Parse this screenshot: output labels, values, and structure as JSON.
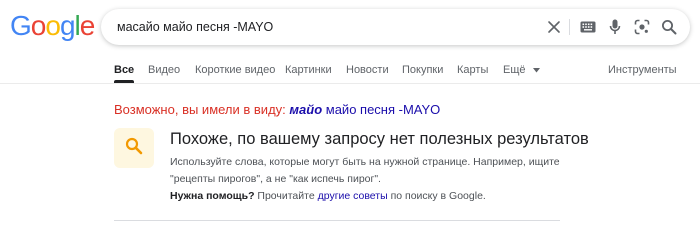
{
  "logo": {
    "letters": [
      "G",
      "o",
      "o",
      "g",
      "l",
      "e"
    ],
    "colors": [
      "#4285f4",
      "#ea4335",
      "#fbbc05",
      "#4285f4",
      "#34a853",
      "#ea4335"
    ]
  },
  "search": {
    "query": "масайо майо песня -MAYO"
  },
  "tabs": {
    "all": "Все",
    "video": "Видео",
    "short_video": "Короткие видео",
    "images": "Картинки",
    "news": "Новости",
    "shopping": "Покупки",
    "maps": "Карты",
    "more": "Ещё",
    "tools": "Инструменты"
  },
  "did_you_mean": {
    "prefix": "Возможно, вы имели в виду:",
    "corrected_word": "майо",
    "rest": "майо песня -MAYO"
  },
  "no_results": {
    "title": "Похоже, по вашему запросу нет полезных результатов",
    "text": "Используйте слова, которые могут быть на нужной странице. Например, ищите \"рецепты пирогов\", а не \"как испечь пирог\".",
    "help_label": "Нужна помощь?",
    "help_mid": "Прочитайте",
    "help_link": "другие советы",
    "help_end": "по поиску в Google."
  },
  "colors": {
    "alert_red": "#d93025",
    "link_blue": "#1a0dab",
    "icon_bg": "#fef7e0",
    "icon_amber": "#f29900"
  }
}
